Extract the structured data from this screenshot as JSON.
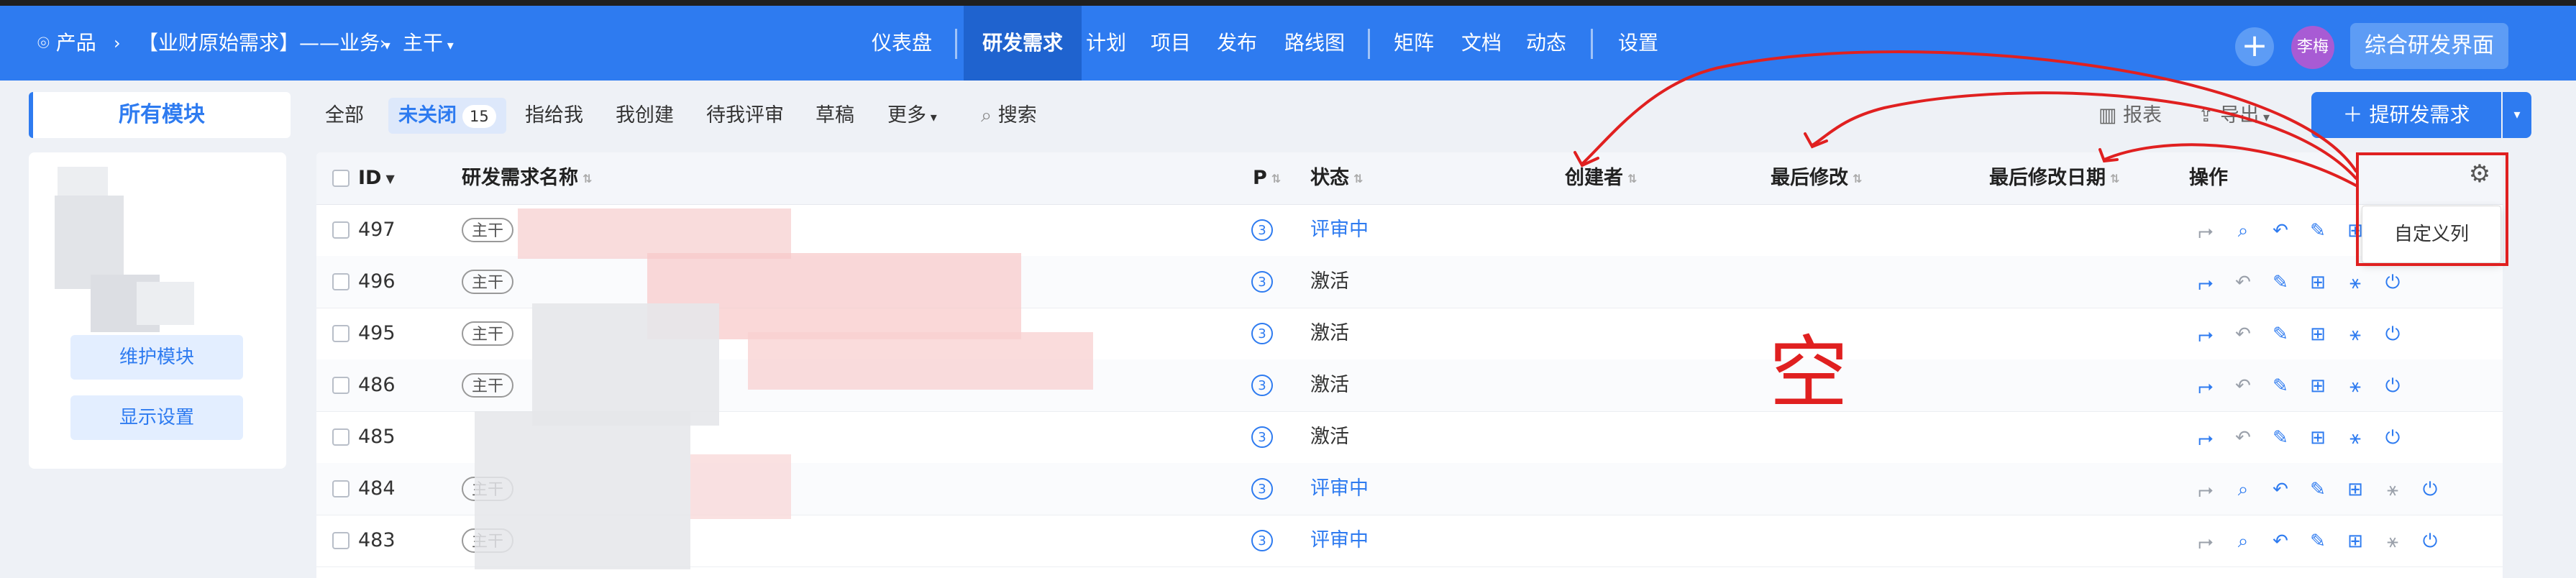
{
  "topbar": {
    "product": "产品",
    "breadcrumb_project": "【业财原始需求】——业务",
    "branch": "主干",
    "nav": [
      "仪表盘",
      "研发需求",
      "计划",
      "项目",
      "发布",
      "路线图",
      "矩阵",
      "文档",
      "动态",
      "设置"
    ],
    "active_nav": "研发需求",
    "user": "李梅",
    "switch_ui": "综合研发界面"
  },
  "sidebar": {
    "header": "所有模块",
    "maintain_button": "维护模块",
    "display_button": "显示设置"
  },
  "filters": {
    "all": "全部",
    "unclosed": "未关闭",
    "unclosed_count": "15",
    "assigned": "指给我",
    "created": "我创建",
    "review": "待我评审",
    "draft": "草稿",
    "more": "更多",
    "search": "搜索"
  },
  "toolbar": {
    "report": "报表",
    "export": "导出",
    "create": "提研发需求"
  },
  "table": {
    "columns": {
      "id": "ID",
      "name": "研发需求名称",
      "priority": "P",
      "status": "状态",
      "creator": "创建者",
      "last_modified": "最后修改",
      "last_modified_date": "最后修改日期",
      "actions": "操作"
    },
    "rows": [
      {
        "id": "497",
        "tag": "主干",
        "priority": "3",
        "status": "评审中",
        "status_type": "review"
      },
      {
        "id": "496",
        "tag": "主干",
        "priority": "3",
        "status": "激活",
        "status_type": "active"
      },
      {
        "id": "495",
        "tag": "主干",
        "priority": "3",
        "status": "激活",
        "status_type": "active"
      },
      {
        "id": "486",
        "tag": "主干",
        "priority": "3",
        "status": "激活",
        "status_type": "active"
      },
      {
        "id": "485",
        "tag": "",
        "priority": "3",
        "status": "激活",
        "status_type": "active"
      },
      {
        "id": "484",
        "tag": "主干",
        "priority": "3",
        "status": "评审中",
        "status_type": "review"
      },
      {
        "id": "483",
        "tag": "主干",
        "priority": "3",
        "status": "评审中",
        "status_type": "review"
      }
    ]
  },
  "settings_popup": {
    "custom_columns": "自定义列"
  },
  "annotation": {
    "empty_mark": "空",
    "color": "#e02020"
  },
  "colors": {
    "primary": "#2e7bf0",
    "topbar": "#2e7bf0"
  }
}
